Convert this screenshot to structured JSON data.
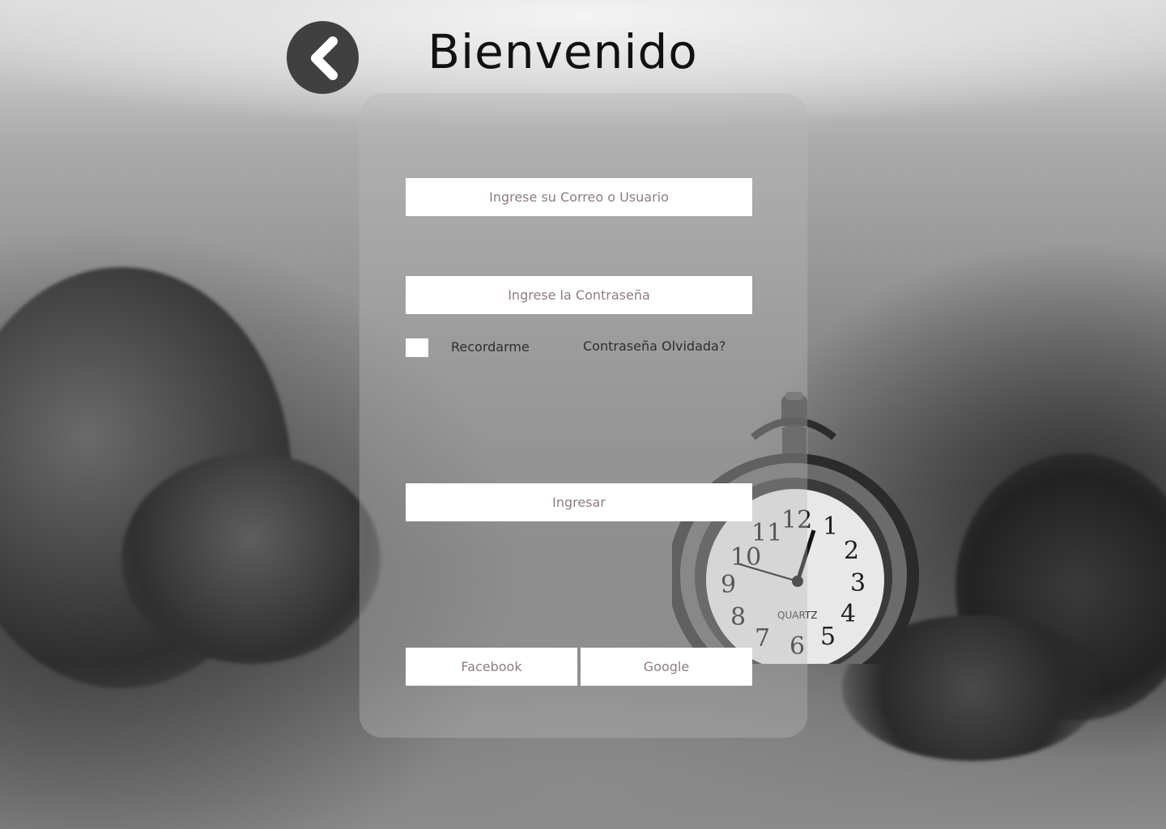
{
  "header": {
    "title": "Bienvenido",
    "back_icon": "chevron-left-icon"
  },
  "form": {
    "email_placeholder": "Ingrese su Correo o Usuario",
    "password_placeholder": "Ingrese la Contraseña",
    "remember_label": "Recordarme",
    "remember_checked": false,
    "forgot_label": "Contraseña Olvidada?",
    "submit_label": "Ingresar"
  },
  "social": {
    "facebook_label": "Facebook",
    "google_label": "Google"
  },
  "background": {
    "watch_brand": "QUARTZ"
  },
  "colors": {
    "back_button": "#404040",
    "input_text": "#8d7c80",
    "card": "rgba(185,185,185,0.38)"
  }
}
